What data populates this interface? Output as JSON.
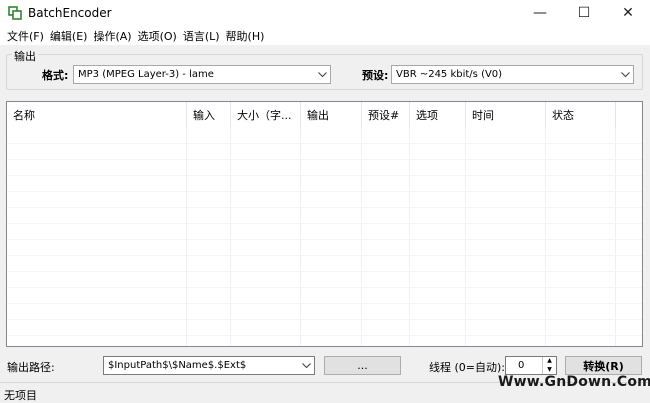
{
  "window": {
    "title": "BatchEncoder",
    "controls": {
      "minimize": "—",
      "maximize": "☐",
      "close": "✕"
    }
  },
  "menu": {
    "items": [
      "文件(F)",
      "编辑(E)",
      "操作(A)",
      "选项(O)",
      "语言(L)",
      "帮助(H)"
    ]
  },
  "output_group": {
    "label": "输出",
    "format_label": "格式:",
    "format_value": "MP3 (MPEG Layer-3) - lame",
    "preset_label": "预设:",
    "preset_value": "VBR ~245 kbit/s (V0)"
  },
  "list": {
    "columns": [
      "名称",
      "输入",
      "大小（字...",
      "输出",
      "预设#",
      "选项",
      "时间",
      "状态"
    ]
  },
  "bottom": {
    "path_label": "输出路径:",
    "path_value": "$InputPath$\\$Name$.$Ext$",
    "browse_label": "...",
    "threads_label": "线程 (0=自动):",
    "threads_value": "0",
    "convert_label": "转换(R)"
  },
  "status": {
    "text": "无项目"
  },
  "watermark": "Www.GnDown.Com"
}
